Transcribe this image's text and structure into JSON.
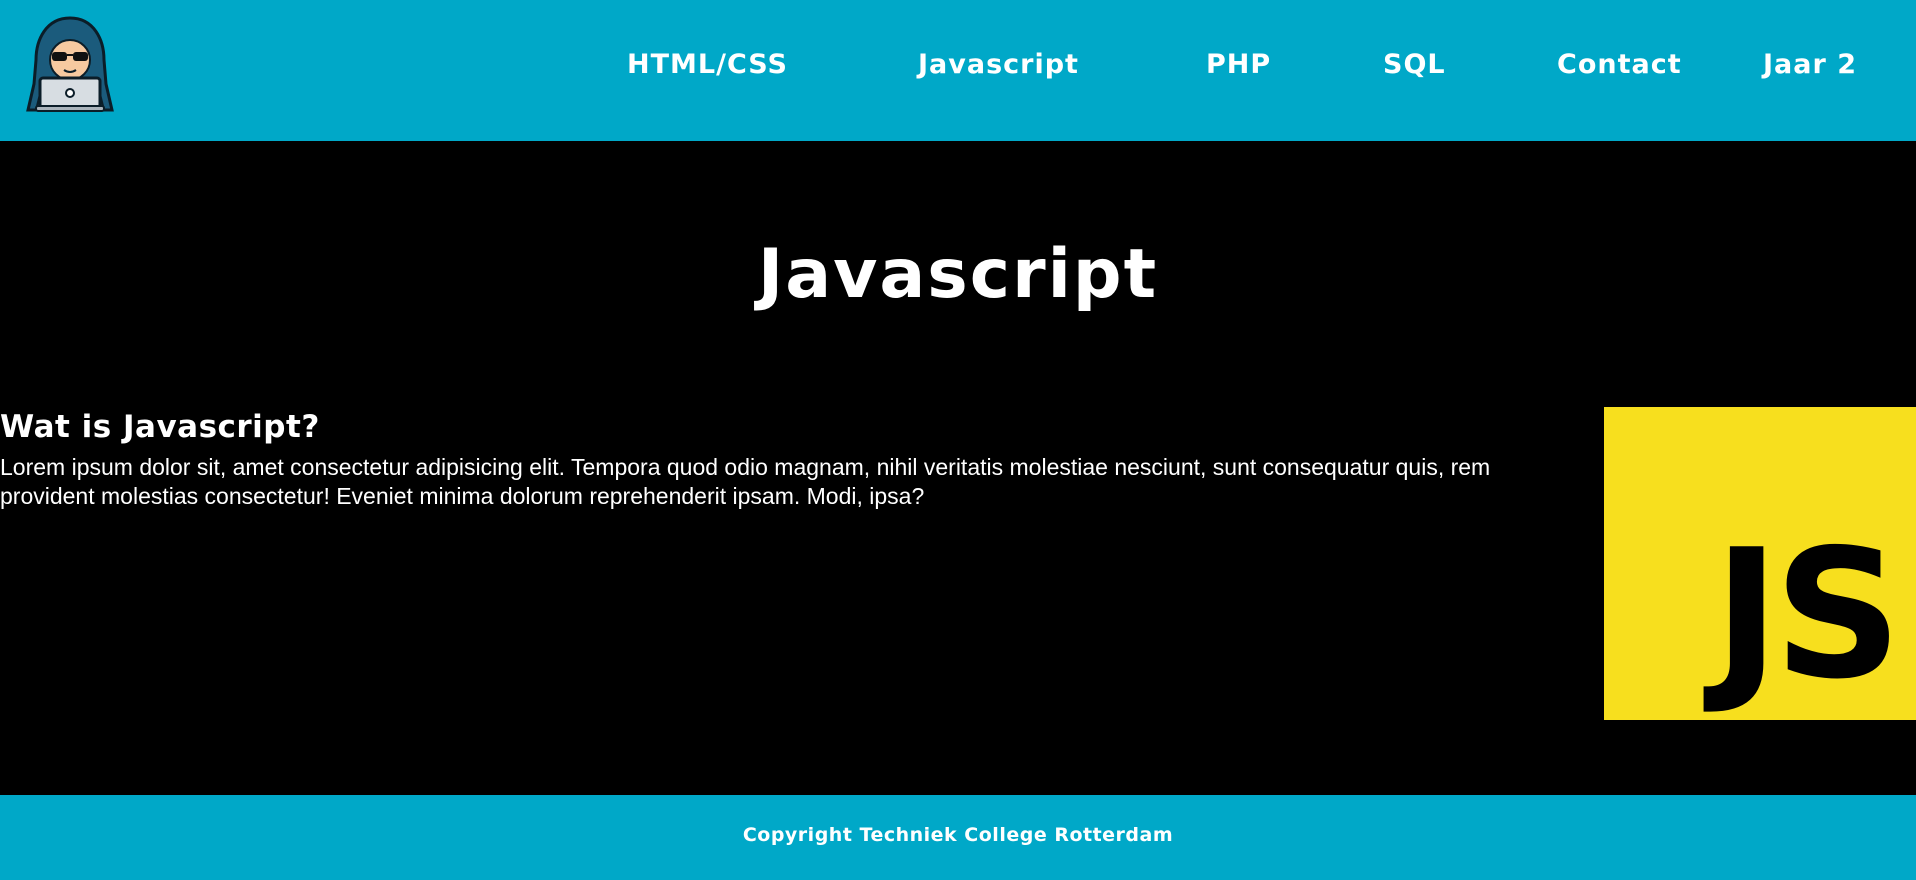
{
  "header": {
    "logo_icon": "hooded-hacker-laptop-icon",
    "background_color": "#00a8c8",
    "nav": [
      {
        "label": "HTML/CSS"
      },
      {
        "label": "Javascript"
      },
      {
        "label": "PHP"
      },
      {
        "label": "SQL"
      },
      {
        "label": "Contact"
      },
      {
        "label": "Jaar 2"
      }
    ]
  },
  "main": {
    "title": "Javascript",
    "section": {
      "heading": "Wat is Javascript?",
      "text": "Lorem ipsum dolor sit, amet consectetur adipisicing elit. Tempora quod odio magnam, nihil veritatis molestiae nesciunt, sunt consequatur quis, rem provident molestias consectetur! Eveniet minima dolorum reprehenderit ipsam. Modi, ipsa?"
    },
    "js_logo": {
      "label": "JS",
      "background_color": "#f7df1e"
    }
  },
  "footer": {
    "text": "Copyright Techniek College Rotterdam"
  }
}
